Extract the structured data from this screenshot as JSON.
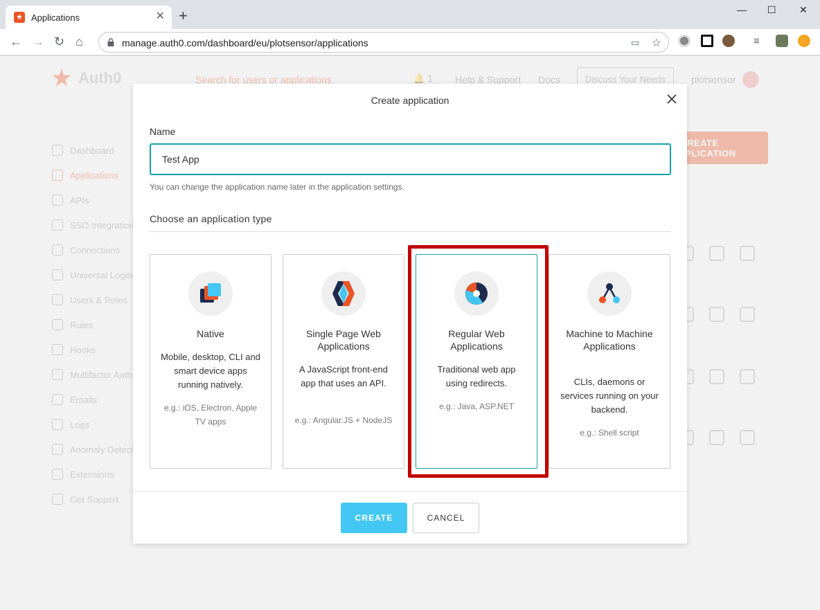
{
  "browser": {
    "tab_title": "Applications",
    "url": "manage.auth0.com/dashboard/eu/plotsensor/applications"
  },
  "background": {
    "brand": "Auth0",
    "search_placeholder": "Search for users or applications",
    "notification_count": "1",
    "help_label": "Help & Support",
    "docs_label": "Docs",
    "discuss_label": "Discuss Your Needs",
    "tenant": "plotsensor",
    "create_button": "+ CREATE APPLICATION",
    "nav": [
      "Dashboard",
      "Applications",
      "APIs",
      "SSO Integrations",
      "Connections",
      "Universal Login",
      "Users & Roles",
      "Rules",
      "Hooks",
      "Multifactor Auth",
      "Emails",
      "Logs",
      "Anomaly Detection",
      "Extensions",
      "Get Support"
    ]
  },
  "modal": {
    "title": "Create application",
    "name_label": "Name",
    "name_value": "Test App",
    "name_hint": "You can change the application name later in the application settings.",
    "type_heading": "Choose an application type",
    "types": [
      {
        "title": "Native",
        "description": "Mobile, desktop, CLI and smart device apps running natively.",
        "example": "e.g.: iOS, Electron, Apple TV apps"
      },
      {
        "title": "Single Page Web Applications",
        "description": "A JavaScript front-end app that uses an API.",
        "example": "e.g.: Angular.JS + NodeJS"
      },
      {
        "title": "Regular Web Applications",
        "description": "Traditional web app using redirects.",
        "example": "e.g.: Java, ASP.NET"
      },
      {
        "title": "Machine to Machine Applications",
        "description": "CLIs, daemons or services running on your backend.",
        "example": "e.g.: Shell script"
      }
    ],
    "selected_type": "Regular Web Applications",
    "create_label": "CREATE",
    "cancel_label": "CANCEL"
  },
  "colors": {
    "accent": "#16a0a8",
    "create_button": "#44c7f4",
    "highlight": "#c00000",
    "brand": "#eb5424"
  }
}
